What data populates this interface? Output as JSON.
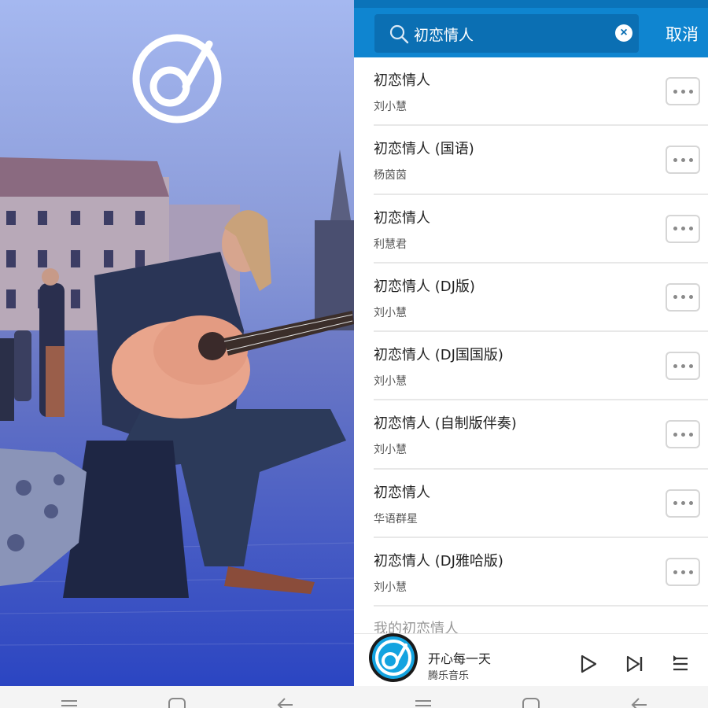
{
  "search": {
    "query": "初恋情人",
    "cancel_label": "取消"
  },
  "results": [
    {
      "title": "初恋情人",
      "artist": "刘小慧"
    },
    {
      "title": "初恋情人 (国语)",
      "artist": "杨茵茵"
    },
    {
      "title": "初恋情人",
      "artist": "利慧君"
    },
    {
      "title": "初恋情人 (DJ版)",
      "artist": "刘小慧"
    },
    {
      "title": "初恋情人 (DJ国国版)",
      "artist": "刘小慧"
    },
    {
      "title": "初恋情人 (自制版伴奏)",
      "artist": "刘小慧"
    },
    {
      "title": "初恋情人",
      "artist": "华语群星"
    },
    {
      "title": "初恋情人 (DJ雅哈版)",
      "artist": "刘小慧"
    }
  ],
  "partial_row_title": "我的初恋情人",
  "player": {
    "song": "开心每一天",
    "source": "腾乐音乐"
  },
  "colors": {
    "header": "#0f85d0",
    "search_box": "#0b6fb3",
    "splash_overlay": "#4a58b5"
  },
  "icons": [
    "app-logo-icon",
    "search-icon",
    "clear-icon",
    "more-icon",
    "play-icon",
    "next-icon",
    "playlist-icon",
    "menu-icon",
    "home-icon",
    "back-icon"
  ]
}
